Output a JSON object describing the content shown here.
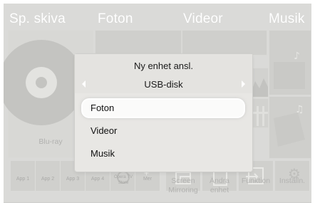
{
  "sections": {
    "disc": "Sp. skiva",
    "photos": "Foton",
    "videos": "Videor",
    "music": "Musik"
  },
  "disc_tile_label": "Blu-ray",
  "apps": [
    {
      "label": "App 1"
    },
    {
      "label": "App 2"
    },
    {
      "label": "App 3"
    },
    {
      "label": "App 4"
    }
  ],
  "opera_store": "Opera TV Store",
  "more_label": "Mer",
  "bottom_tiles": {
    "screen_mirroring": "Screen Mirroring",
    "change_device": "Ändra enhet",
    "function": "Funktion",
    "settings": "Inställn."
  },
  "dialog": {
    "title": "Ny enhet ansl.",
    "device": "USB-disk",
    "options": [
      {
        "label": "Foton",
        "selected": true
      },
      {
        "label": "Videor",
        "selected": false
      },
      {
        "label": "Musik",
        "selected": false
      }
    ]
  },
  "colors": {
    "background": "#dadad8",
    "dialog": "#e8e7e4",
    "focus": "#ffffff"
  }
}
